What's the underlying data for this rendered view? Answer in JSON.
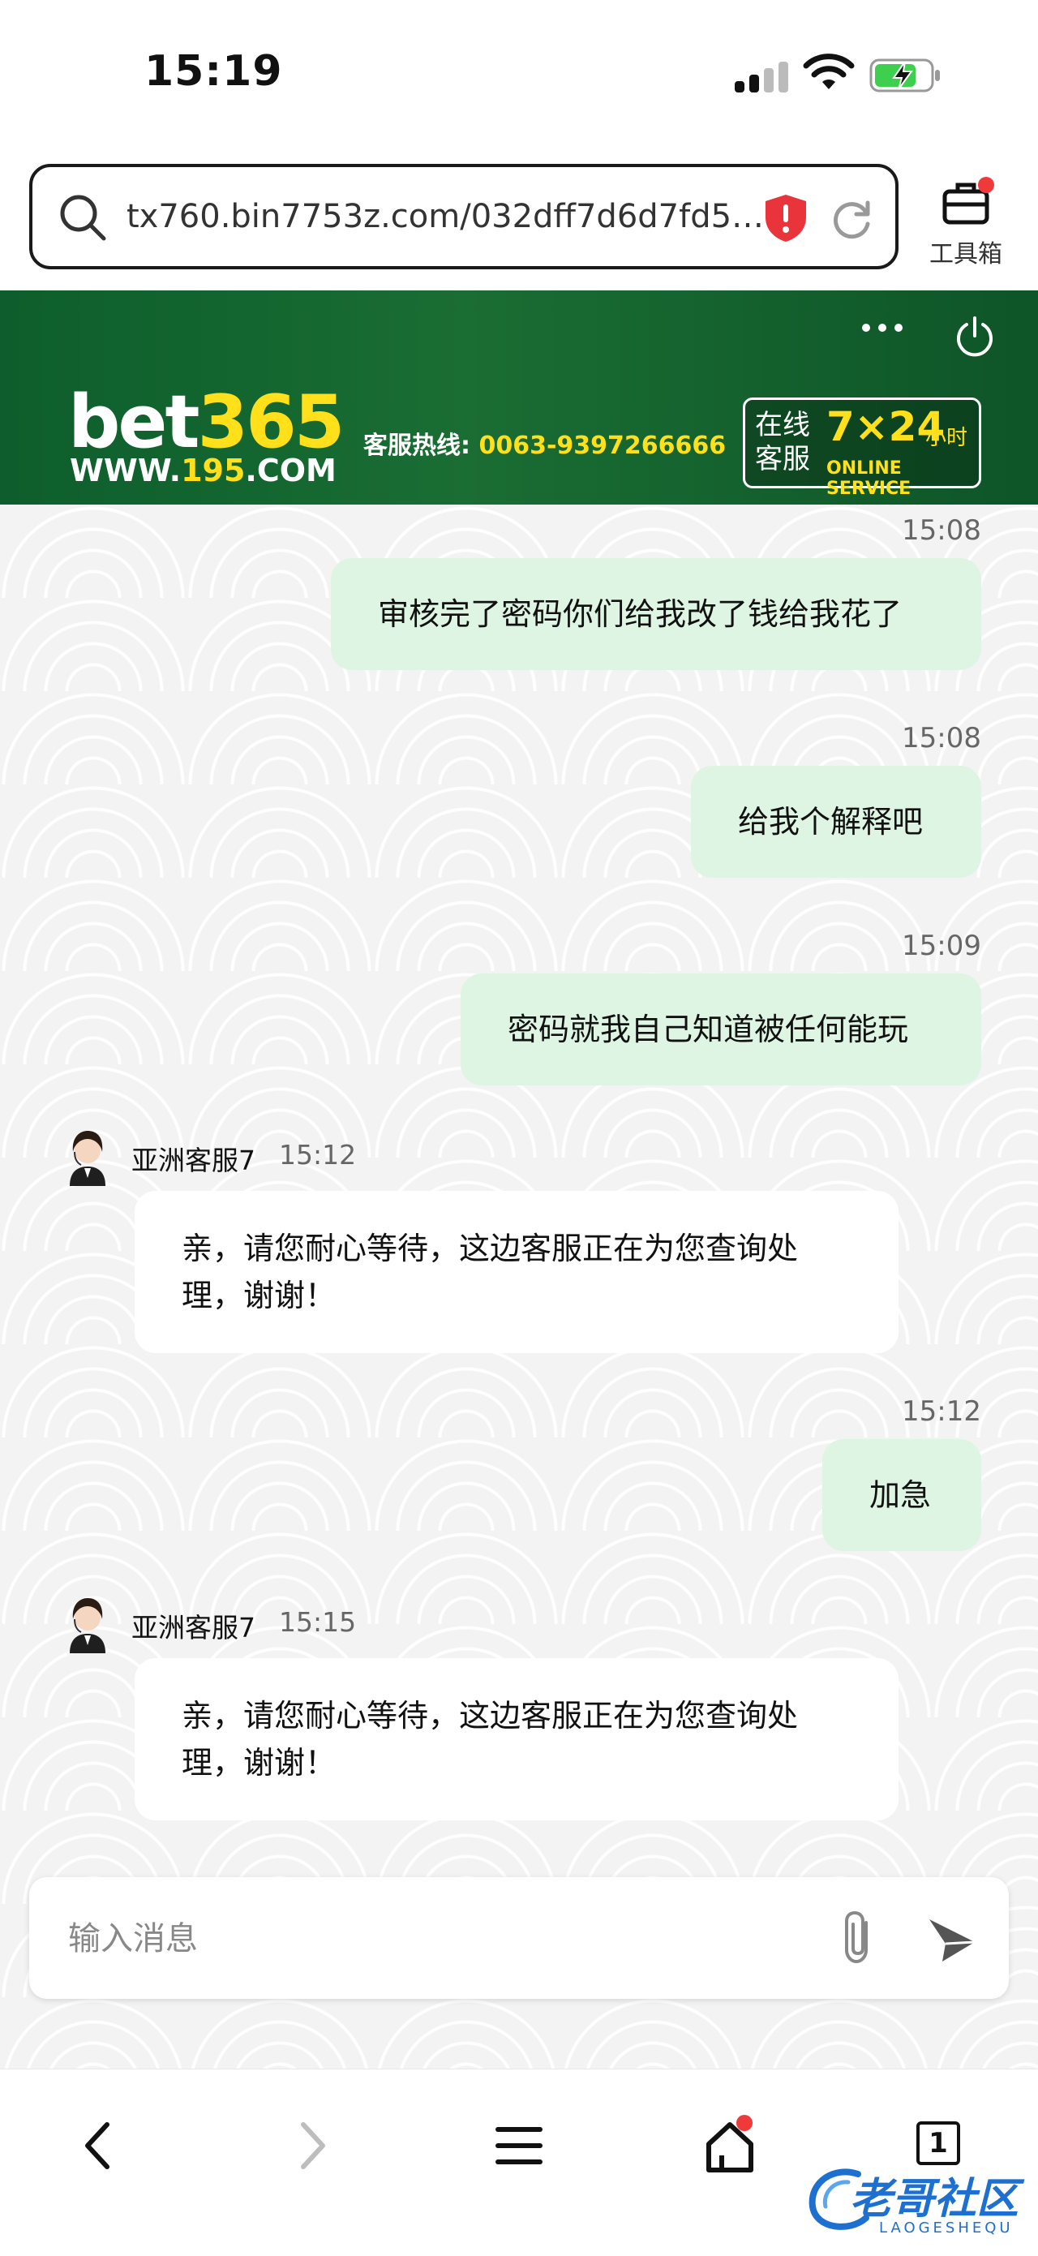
{
  "status_bar": {
    "time": "15:19"
  },
  "browser": {
    "url": "tx760.bin7753z.com/032dff7d6d7fd55j...",
    "toolbox_label": "工具箱"
  },
  "header": {
    "logo_bet": "bet",
    "logo_num": "365",
    "logo_url_prefix": "WWW.",
    "logo_url_num": "195",
    "logo_url_suffix": ".COM",
    "hotline_label": "客服热线:",
    "hotline_number": "0063-9397266666",
    "service_cn": "在线客服",
    "service_724": "7×24",
    "service_hours": "小时",
    "service_en": "ONLINE SERVICE"
  },
  "messages": [
    {
      "sender": "me",
      "time": "15:08",
      "text": "审核完了密码你们给我改了钱给我花了"
    },
    {
      "sender": "me",
      "time": "15:08",
      "text": "给我个解释吧"
    },
    {
      "sender": "me",
      "time": "15:09",
      "text": "密码就我自己知道被任何能玩"
    },
    {
      "sender": "agent",
      "name": "亚洲客服7",
      "time": "15:12",
      "text": "亲，请您耐心等待，这边客服正在为您查询处理，谢谢！"
    },
    {
      "sender": "me",
      "time": "15:12",
      "text": "加急"
    },
    {
      "sender": "agent",
      "name": "亚洲客服7",
      "time": "15:15",
      "text": "亲，请您耐心等待，这边客服正在为您查询处理，谢谢！"
    }
  ],
  "input": {
    "placeholder": "输入消息"
  },
  "bottom_nav": {
    "tab_count": "1"
  },
  "watermark": {
    "text": "老哥社区",
    "sub": "LAOGESHEQU"
  },
  "colors": {
    "header_green": "#1a6d33",
    "accent_yellow": "#ffe01a",
    "bubble_out": "#dff5e3",
    "bubble_in": "#ffffff",
    "badge_red": "#f03a3a"
  },
  "icons": [
    "search-icon",
    "shield-icon",
    "reload-icon",
    "toolbox-icon",
    "more-icon",
    "power-icon",
    "avatar",
    "paperclip-icon",
    "send-icon",
    "back-icon",
    "forward-icon",
    "menu-icon",
    "home-icon",
    "tabs-icon"
  ]
}
